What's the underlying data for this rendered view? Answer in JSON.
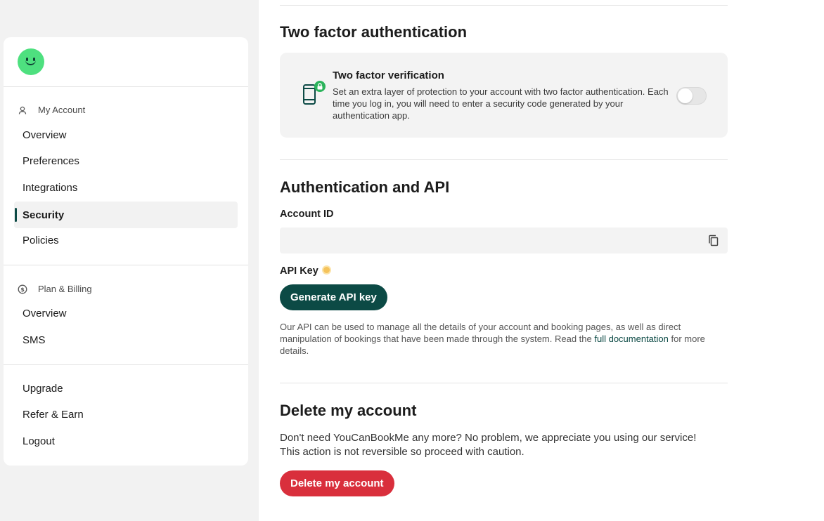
{
  "sidebar": {
    "account_group": "My Account",
    "account_items": [
      {
        "label": "Overview"
      },
      {
        "label": "Preferences"
      },
      {
        "label": "Integrations"
      },
      {
        "label": "Security"
      },
      {
        "label": "Policies"
      }
    ],
    "billing_group": "Plan & Billing",
    "billing_items": [
      {
        "label": "Overview"
      },
      {
        "label": "SMS"
      }
    ],
    "bottom_items": [
      {
        "label": "Upgrade"
      },
      {
        "label": "Refer & Earn"
      },
      {
        "label": "Logout"
      }
    ]
  },
  "two_factor": {
    "heading": "Two factor authentication",
    "card_title": "Two factor verification",
    "card_description": "Set an extra layer of protection to your account with two factor authentication. Each time you log in, you will need to enter a security code generated by your authentication app."
  },
  "auth_api": {
    "heading": "Authentication and API",
    "account_id_label": "Account ID",
    "account_id_value": "",
    "api_key_label": "API Key",
    "generate_button": "Generate API key",
    "description_before": "Our API can be used to manage all the details of your account and booking pages, as well as direct manipulation of bookings that have been made through the system. Read the ",
    "doc_link": "full documentation",
    "description_after": " for more details."
  },
  "delete": {
    "heading": "Delete my account",
    "line1": "Don't need YouCanBookMe any more? No problem, we appreciate you using our service!",
    "line2": "This action is not reversible so proceed with caution.",
    "button": "Delete my account"
  },
  "colors": {
    "accent": "#0c4a45",
    "danger": "#d92f3c",
    "logo": "#4ee07f"
  }
}
